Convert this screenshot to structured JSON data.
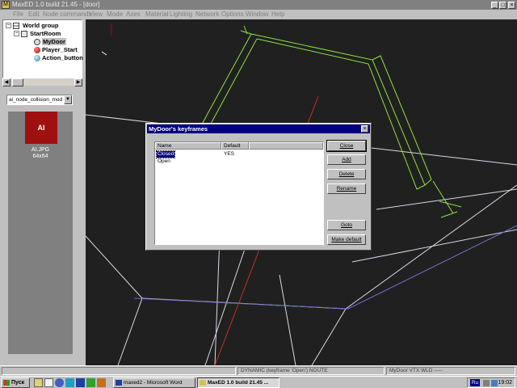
{
  "titlebar": {
    "title": "MaxED 1.0 build 21.45 - [door]",
    "min": "_",
    "max": "□",
    "close": "×"
  },
  "menu": [
    "File",
    "Edit",
    "Node commands",
    "View",
    "Mode",
    "Axes",
    "Material",
    "Lighting",
    "Network",
    "Options",
    "Window",
    "Help"
  ],
  "tree": {
    "items": [
      {
        "label": "World group",
        "expander": "−"
      },
      {
        "label": "StartRoom",
        "expander": "−"
      },
      {
        "label": "MyDoor"
      },
      {
        "label": "Player_Start"
      },
      {
        "label": "Action_button"
      }
    ]
  },
  "combo": {
    "value": "ai_node_collision_mod"
  },
  "texture": {
    "thumb_label": "AI",
    "name": "AI.JPG",
    "size": "64x64"
  },
  "dialog": {
    "title": "MyDoor's keyframes",
    "close": "×",
    "columns": [
      "Name",
      "Default",
      ""
    ],
    "rows": [
      {
        "name": "Closed",
        "default": "YES"
      },
      {
        "name": "Open",
        "default": ""
      }
    ],
    "buttons": {
      "close": "Close",
      "add": "Add",
      "delete": "Delete",
      "rename": "Rename",
      "goto": "Goto",
      "make_default": "Make default"
    }
  },
  "statusbar": {
    "panels": [
      "",
      "DYNAMIC (keyframe 'Open') NOUTE",
      "MyDoor VTX WLD -----"
    ]
  },
  "taskbar": {
    "start": "Пуск",
    "tasks": [
      {
        "label": "maxed2 - Microsoft Word",
        "active": false
      },
      {
        "label": "MaxED 1.0 build 21.45 ...",
        "active": true
      }
    ],
    "lang": "Ru",
    "clock": "19:02"
  }
}
